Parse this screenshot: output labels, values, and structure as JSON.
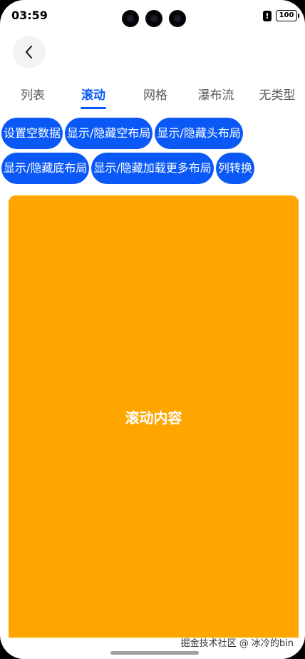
{
  "status_bar": {
    "time": "03:59",
    "alert": "!",
    "battery": "100"
  },
  "icons": {
    "back": "chevron-left-icon"
  },
  "tabs": [
    {
      "label": "列表",
      "active": false
    },
    {
      "label": "滚动",
      "active": true
    },
    {
      "label": "网格",
      "active": false
    },
    {
      "label": "瀑布流",
      "active": false
    },
    {
      "label": "无类型",
      "active": false
    }
  ],
  "buttons": {
    "set_empty": "设置空数据",
    "toggle_empty_layout": "显示/隐藏空布局",
    "toggle_header_layout": "显示/隐藏头布局",
    "toggle_footer_layout": "显示/隐藏底布局",
    "toggle_load_more_layout": "显示/隐藏加载更多布局",
    "switch_columns": "列转换"
  },
  "content": {
    "label": "滚动内容"
  },
  "watermark": "掘金技术社区 @ 冰冷的bin",
  "colors": {
    "accent": "#0a59f7",
    "content_bg": "#ffa500",
    "tab_inactive": "#5a5a5a"
  }
}
